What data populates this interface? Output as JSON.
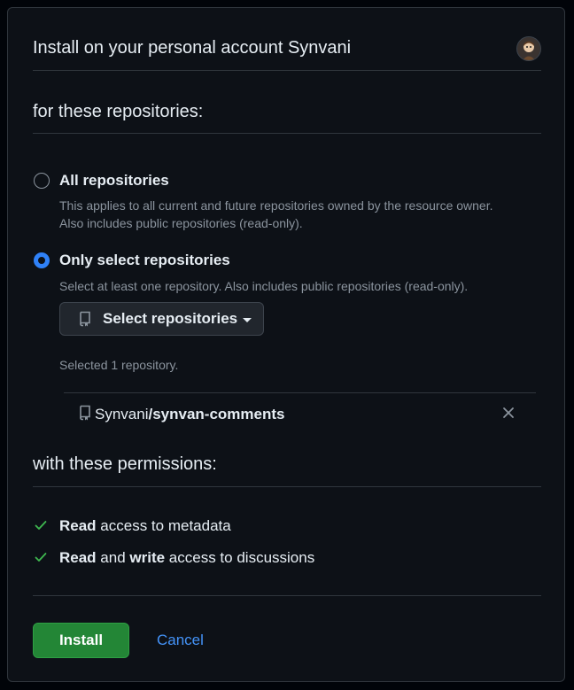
{
  "header": {
    "title": "Install on your personal account Synvani",
    "avatar_icon": "user-avatar-icon"
  },
  "repositories": {
    "section_title": "for these repositories:",
    "options": [
      {
        "label": "All repositories",
        "description_line1": "This applies to all current and future repositories owned by the resource owner.",
        "description_line2": "Also includes public repositories (read-only).",
        "checked": false
      },
      {
        "label": "Only select repositories",
        "description_line1": "Select at least one repository. Also includes public repositories (read-only).",
        "checked": true
      }
    ],
    "select_button_label": "Select repositories",
    "selected_count_text": "Selected 1 repository.",
    "selected": [
      {
        "owner": "Synvani",
        "separator": "/",
        "name": "synvan-comments"
      }
    ]
  },
  "permissions": {
    "section_title": "with these permissions:",
    "items": [
      {
        "bold1": "Read",
        "text1": " access to metadata",
        "bold2": "",
        "text2": ""
      },
      {
        "bold1": "Read",
        "text1": " and ",
        "bold2": "write",
        "text2": " access to discussions"
      }
    ]
  },
  "actions": {
    "install_label": "Install",
    "cancel_label": "Cancel"
  },
  "colors": {
    "accent": "#2f81f7",
    "install_green": "#238636",
    "check_green": "#3fb950",
    "link_blue": "#4493f8"
  }
}
